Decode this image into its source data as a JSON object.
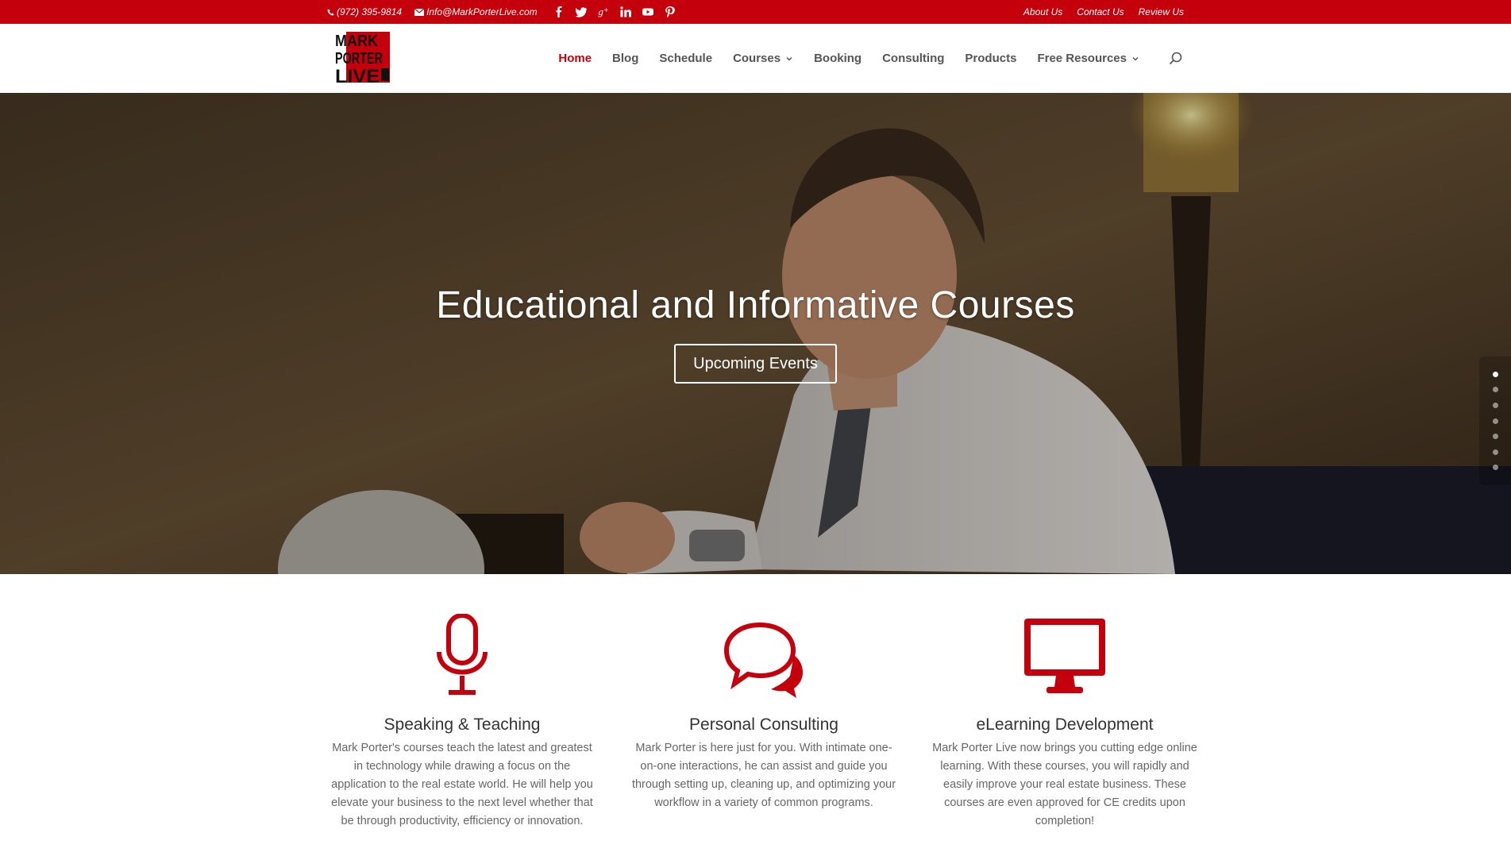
{
  "topbar": {
    "phone": "(972) 395-9814",
    "email": "Info@MarkPorterLive.com",
    "social": [
      "facebook-icon",
      "twitter-icon",
      "google-plus-icon",
      "linkedin-icon",
      "youtube-icon",
      "pinterest-icon"
    ],
    "links": [
      "About Us",
      "Contact Us",
      "Review Us"
    ]
  },
  "logo": {
    "line1": "MARK",
    "line2": "PORTER",
    "line3": "LIVE"
  },
  "nav": {
    "items": [
      "Home",
      "Blog",
      "Schedule",
      "Courses",
      "Booking",
      "Consulting",
      "Products",
      "Free Resources"
    ],
    "active": "Home"
  },
  "hero": {
    "title": "Educational and Informative Courses",
    "button": "Upcoming Events",
    "slide_count": 7,
    "active_slide": 1
  },
  "features": [
    {
      "icon": "microphone-icon",
      "title": "Speaking & Teaching",
      "text": "Mark Porter's courses teach the latest and greatest in technology while drawing a focus on the application to the real estate world. He will help you elevate your business to the next level whether that be through productivity, efficiency or innovation."
    },
    {
      "icon": "chat-bubbles-icon",
      "title": "Personal Consulting",
      "text": "Mark Porter is here just for you. With intimate one-on-one interactions, he can assist and guide you through setting up, cleaning up, and optimizing your workflow in a variety of common programs."
    },
    {
      "icon": "desktop-monitor-icon",
      "title": "eLearning Development",
      "text": "Mark Porter Live now brings you cutting edge online learning. With these courses, you will rapidly and easily improve your real estate business. These courses are even approved for CE credits upon completion!"
    }
  ],
  "colors": {
    "brand_red": "#c4000d"
  }
}
